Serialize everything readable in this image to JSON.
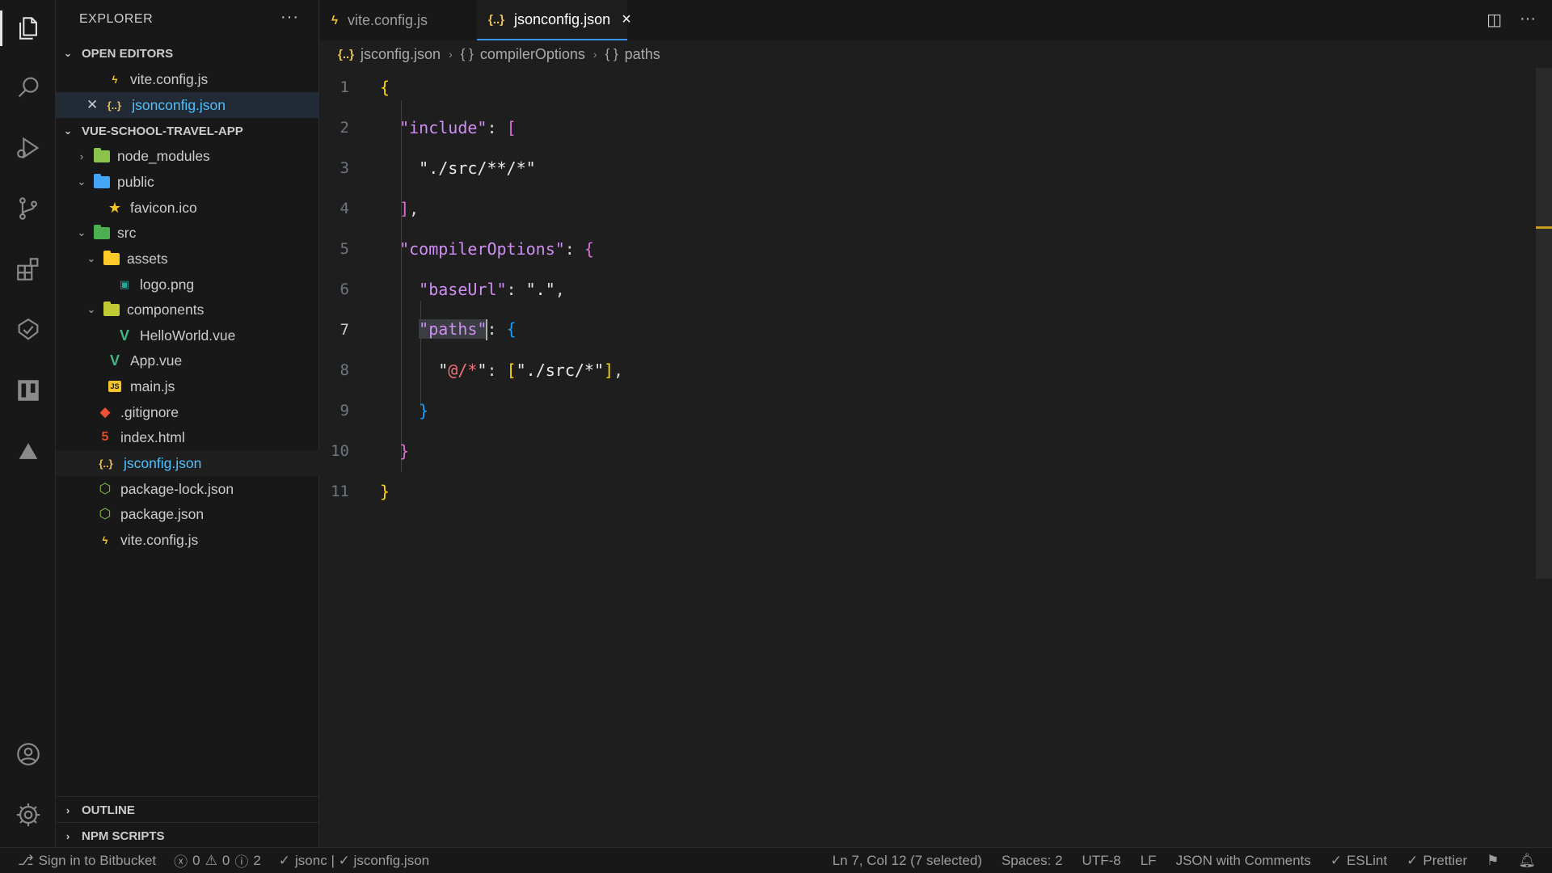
{
  "sidebar": {
    "title": "EXPLORER",
    "more": "···",
    "open_editors": {
      "heading": "OPEN EDITORS",
      "items": [
        {
          "label": "vite.config.js",
          "icon": "vite-icon"
        },
        {
          "label": "jsonconfig.json",
          "icon": "json-icon"
        }
      ]
    },
    "project": {
      "heading": "VUE-SCHOOL-TRAVEL-APP",
      "items": [
        {
          "label": "node_modules"
        },
        {
          "label": "public"
        },
        {
          "label": "favicon.ico"
        },
        {
          "label": "src"
        },
        {
          "label": "assets"
        },
        {
          "label": "logo.png"
        },
        {
          "label": "components"
        },
        {
          "label": "HelloWorld.vue"
        },
        {
          "label": "App.vue"
        },
        {
          "label": "main.js"
        },
        {
          "label": ".gitignore"
        },
        {
          "label": "index.html"
        },
        {
          "label": "jsconfig.json"
        },
        {
          "label": "package-lock.json"
        },
        {
          "label": "package.json"
        },
        {
          "label": "vite.config.js"
        }
      ]
    },
    "outline": "OUTLINE",
    "npm_scripts": "NPM SCRIPTS"
  },
  "tabs": [
    {
      "label": "vite.config.js",
      "active": false
    },
    {
      "label": "jsonconfig.json",
      "active": true
    }
  ],
  "breadcrumb": {
    "file": "jsconfig.json",
    "parts": [
      "compilerOptions",
      "paths"
    ],
    "sep": "›"
  },
  "editor": {
    "line_numbers": [
      "1",
      "2",
      "3",
      "4",
      "5",
      "6",
      "7",
      "8",
      "9",
      "10",
      "11"
    ],
    "current_line": 7
  },
  "status": {
    "bitbucket": "Sign in to Bitbucket",
    "errors": "0",
    "warnings": "0",
    "infos": "2",
    "language_check": "jsonc | ✓ jsconfig.json",
    "position": "Ln 7, Col 12 (7 selected)",
    "spaces": "Spaces: 2",
    "encoding": "UTF-8",
    "eol": "LF",
    "language": "JSON with Comments",
    "eslint": "ESLint",
    "prettier": "Prettier"
  },
  "colors": {
    "accent": "#3794ff",
    "json_icon": "#e8c35a",
    "vue": "#41b883",
    "html": "#e44d26",
    "git": "#f05033",
    "npm_json": "#8bc34a"
  }
}
